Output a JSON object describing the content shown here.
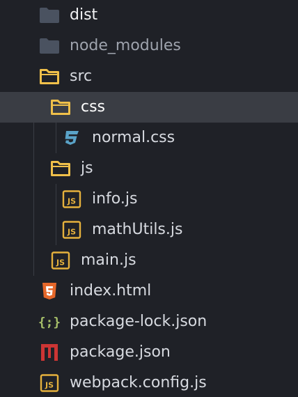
{
  "tree": {
    "items": [
      {
        "label": "dist",
        "icon": "folder-closed-icon"
      },
      {
        "label": "node_modules",
        "icon": "folder-closed-icon"
      },
      {
        "label": "src",
        "icon": "folder-open-icon"
      },
      {
        "label": "css",
        "icon": "folder-open-icon",
        "selected": true
      },
      {
        "label": "normal.css",
        "icon": "css-file-icon"
      },
      {
        "label": "js",
        "icon": "folder-open-icon"
      },
      {
        "label": "info.js",
        "icon": "js-file-icon"
      },
      {
        "label": "mathUtils.js",
        "icon": "js-file-icon"
      },
      {
        "label": "main.js",
        "icon": "js-file-icon"
      },
      {
        "label": "index.html",
        "icon": "html-file-icon"
      },
      {
        "label": "package-lock.json",
        "icon": "json-file-icon"
      },
      {
        "label": "package.json",
        "icon": "npm-file-icon"
      },
      {
        "label": "webpack.config.js",
        "icon": "js-file-icon"
      }
    ]
  },
  "colors": {
    "background": "#1f2127",
    "selection": "#3a3d44",
    "folder_dark": "#4a5260",
    "folder_open": "#f0c04a",
    "js_badge": "#e5b13d",
    "css_icon": "#5aa3c8",
    "html_icon": "#e5672a",
    "json_icon": "#a7c06a",
    "npm_icon": "#cc3534"
  }
}
